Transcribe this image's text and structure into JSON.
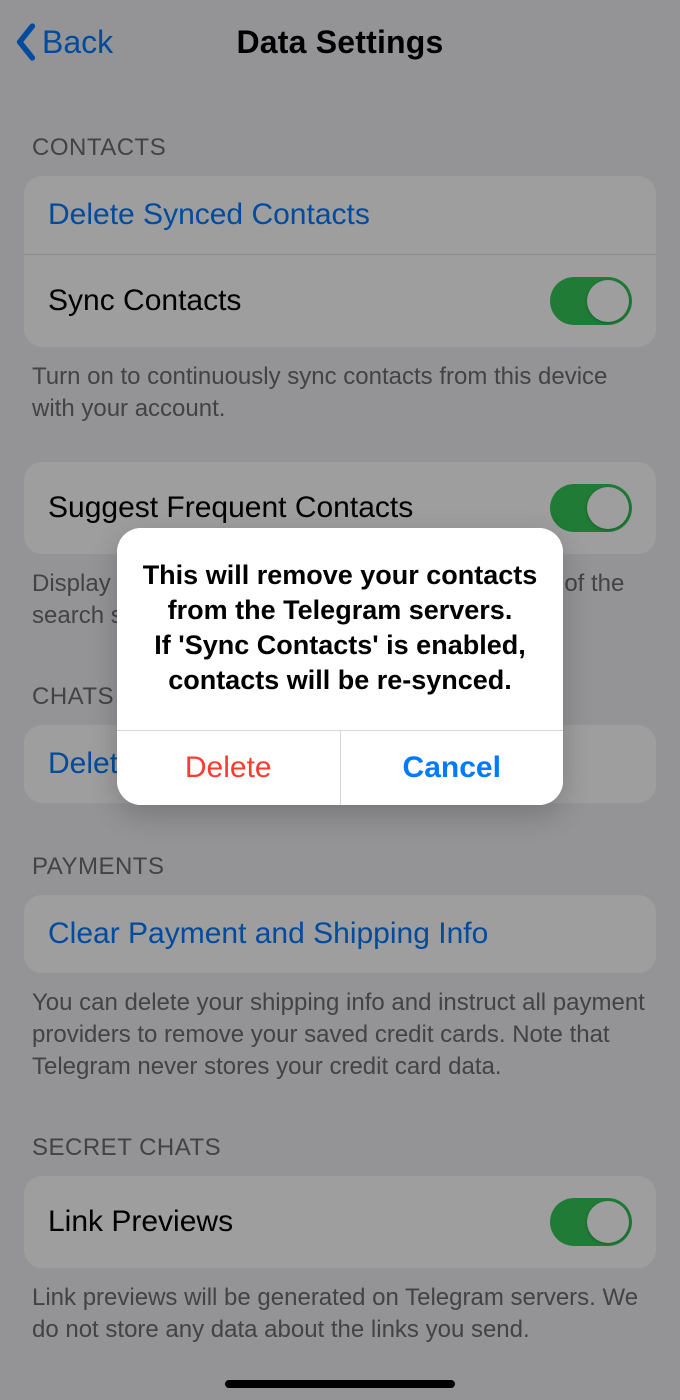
{
  "nav": {
    "back": "Back",
    "title": "Data Settings"
  },
  "contacts": {
    "header": "CONTACTS",
    "delete": "Delete Synced Contacts",
    "sync": "Sync Contacts",
    "footer": "Turn on to continuously sync contacts from this device with your account."
  },
  "suggest": {
    "label": "Suggest Frequent Contacts",
    "footer": "Display people you message frequently at the top of the search section for quick access."
  },
  "chats": {
    "header": "CHATS",
    "delete": "Delete All Cloud Drafts"
  },
  "payments": {
    "header": "PAYMENTS",
    "clear": "Clear Payment and Shipping Info",
    "footer": "You can delete your shipping info and instruct all payment providers to remove your saved credit cards. Note that Telegram never stores your credit card data."
  },
  "secret": {
    "header": "SECRET CHATS",
    "link": "Link Previews",
    "footer": "Link previews will be generated on Telegram servers. We do not store any data about the links you send."
  },
  "alert": {
    "message": "This will remove your contacts from the Telegram servers.\nIf 'Sync Contacts' is enabled, contacts will be re-synced.",
    "delete": "Delete",
    "cancel": "Cancel"
  }
}
